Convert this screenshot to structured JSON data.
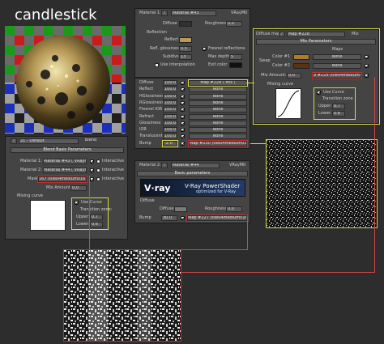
{
  "title": "candlestick",
  "colors": {
    "accent_yellow": "#d8d84a",
    "accent_red": "#c03030",
    "panel": "#444444",
    "bg": "#2d2d2d"
  },
  "blend_panel": {
    "material_selector": "21 - Default",
    "type": "Blend",
    "rollout": "Blend Basic Parameters",
    "material1_label": "Material 1:",
    "material1_value": "Material #43 ( VRayMtl )",
    "material2_label": "Material 2:",
    "material2_value": "Material #44 ( VRayMtl )",
    "mask_label": "Mask:",
    "mask_value": "167 (tile04medium016.jpg)",
    "interactive": "Interactive",
    "mix_amount_label": "Mix Amount:",
    "mix_amount": "0.0",
    "mixing_curve": "Mixing curve",
    "use_curve": "Use Curve",
    "transition_zone": "Transition zone:",
    "upper_label": "Upper:",
    "upper": "0.7",
    "lower_label": "Lower:",
    "lower": "0.6"
  },
  "mtl43_panel": {
    "label": "Material 1:",
    "name": "Material #43",
    "type": "VRayMtl",
    "diffuse": "Diffuse",
    "roughness_label": "Roughness",
    "roughness": "0.0",
    "reflection": "Reflection",
    "reflect": "Reflect",
    "refl_gloss_label": "Refl. glossiness",
    "refl_gloss": "0.5",
    "fresnel": "Fresnel reflections",
    "subdivs_label": "Subdivs",
    "subdivs": "13",
    "max_depth_label": "Max depth",
    "max_depth": "5",
    "use_interp": "Use interpolation",
    "exit_color": "Exit color",
    "maps_rows": [
      {
        "name": "Diffuse",
        "amt": "100.0",
        "map": "Map #228 ( Mix )"
      },
      {
        "name": "Reflect",
        "amt": "100.0",
        "map": "None"
      },
      {
        "name": "HGlossiness",
        "amt": "100.0",
        "map": "None"
      },
      {
        "name": "RGlossiness",
        "amt": "100.0",
        "map": "None"
      },
      {
        "name": "Fresnel IOR",
        "amt": "100.0",
        "map": "None"
      },
      {
        "name": "Refract",
        "amt": "100.0",
        "map": "None"
      },
      {
        "name": "Glossiness",
        "amt": "100.0",
        "map": "None"
      },
      {
        "name": "IOR",
        "amt": "100.0",
        "map": "None"
      },
      {
        "name": "Translucent",
        "amt": "100.0",
        "map": "None"
      }
    ],
    "bump_label": "Bump",
    "bump_amt": "-2.0",
    "bump_map": "Map #230 (tile04medium033.jpg)"
  },
  "mix_panel": {
    "label": "Diffuse map:",
    "name": "Map #228",
    "type": "Mix",
    "rollout": "Mix Parameters",
    "maps": "Maps",
    "swap": "Swap",
    "color1": "Color #1",
    "color2": "Color #2",
    "none": "None",
    "mix_amount_label": "Mix Amount:",
    "mix_amount": "0.0",
    "mix_map": "p #229 (tile04medium016.jpg)",
    "mixing_curve": "Mixing curve",
    "use_curve": "Use Curve",
    "transition_zone": "Transition zone",
    "upper_label": "Upper:",
    "upper": "0.7",
    "lower_label": "Lower:",
    "lower": "0.6"
  },
  "mtl44_panel": {
    "label": "Material 2:",
    "name": "Material #44",
    "type": "VRayMtl",
    "rollout": "Basic parameters",
    "vray_logo": "V·ray",
    "vray_title": "V-Ray PowerShader",
    "vray_subtitle": "optimized for V-Ray",
    "diffuse_group": "Diffuse",
    "diffuse": "Diffuse",
    "roughness_label": "Roughness",
    "roughness": "0.0",
    "bump_label": "Bump",
    "bump_amt": "30.0",
    "bump_map": "Map #227 (tile04medium016.jpg)"
  }
}
